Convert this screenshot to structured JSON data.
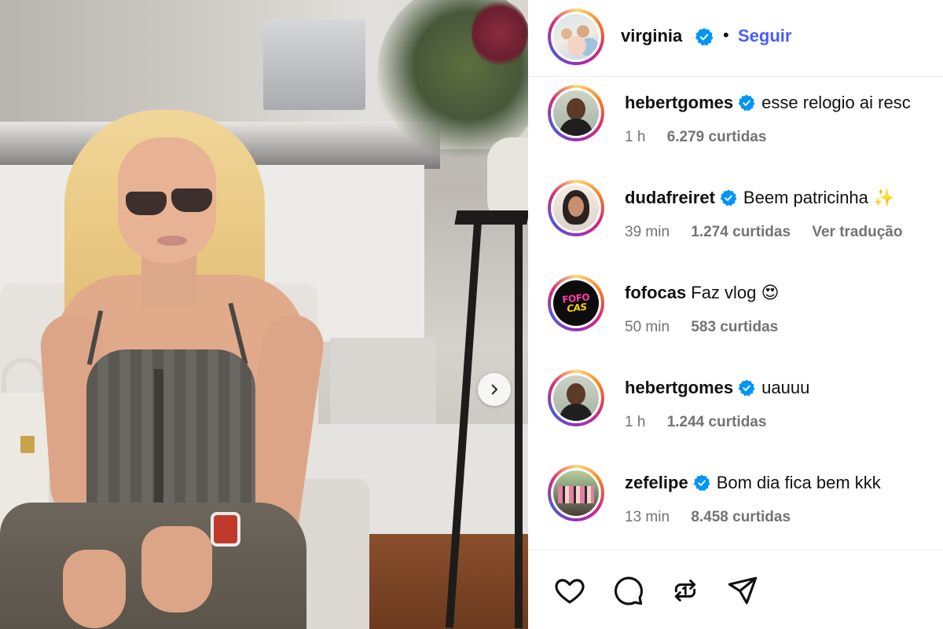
{
  "post": {
    "next_icon": "chevron-right-icon"
  },
  "header": {
    "username": "virginia",
    "verified_icon": "verified-badge-icon",
    "separator": "•",
    "follow_label": "Seguir",
    "follow_color": "#4a5df9"
  },
  "comments": [
    {
      "username": "hebertgomes",
      "verified": true,
      "text": "esse relogio ai resc",
      "time": "1 h",
      "likes": "6.279 curtidas",
      "translate": ""
    },
    {
      "username": "dudafreiret",
      "verified": true,
      "text": "Beem patricinha ✨",
      "time": "39 min",
      "likes": "1.274 curtidas",
      "translate": "Ver tradução"
    },
    {
      "username": "fofocas",
      "verified": false,
      "text": "Faz vlog 😍",
      "time": "50 min",
      "likes": "583 curtidas",
      "translate": "",
      "avatar_text_top": "FOFO",
      "avatar_text_bottom": "CAS"
    },
    {
      "username": "hebertgomes",
      "verified": true,
      "text": "uauuu",
      "time": "1 h",
      "likes": "1.244 curtidas",
      "translate": ""
    },
    {
      "username": "zefelipe",
      "verified": true,
      "text": "Bom dia fica bem kkk",
      "time": "13 min",
      "likes": "8.458 curtidas",
      "translate": ""
    }
  ],
  "actions": {
    "like_icon": "heart-icon",
    "comment_icon": "comment-icon",
    "share_icon": "repost-icon",
    "send_icon": "send-icon"
  },
  "colors": {
    "verified": "#0095f6",
    "meta_text": "#737373",
    "story_ring_start": "#feda75",
    "story_ring_end": "#d62976"
  }
}
